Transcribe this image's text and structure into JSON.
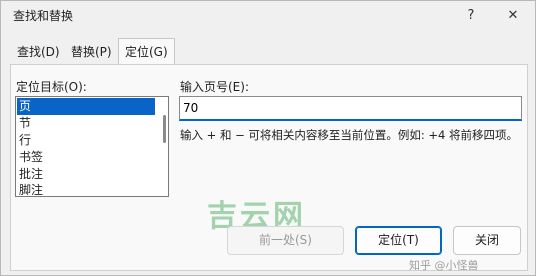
{
  "window": {
    "title": "查找和替换",
    "help_glyph": "?",
    "close_glyph": "✕"
  },
  "tabs": [
    {
      "label": "查找(D)"
    },
    {
      "label": "替换(P)"
    },
    {
      "label": "定位(G)",
      "active": true
    }
  ],
  "goto": {
    "target_label": "定位目标(O):",
    "targets": [
      "页",
      "节",
      "行",
      "书签",
      "批注",
      "脚注"
    ],
    "selected_target": "页",
    "input_label": "输入页号(E):",
    "input_value": "70",
    "hint": "输入 + 和 − 可将相关内容移至当前位置。例如: +4 将前移四项。"
  },
  "buttons": {
    "previous": "前一处(S)",
    "goto": "定位(T)",
    "close": "关闭"
  },
  "watermarks": {
    "site": "吉云网",
    "zhihu": "知乎 @小怪兽"
  },
  "colors": {
    "selection": "#0a64c8",
    "focus_underline": "#0066cc",
    "default_button_border": "#0067c0"
  }
}
